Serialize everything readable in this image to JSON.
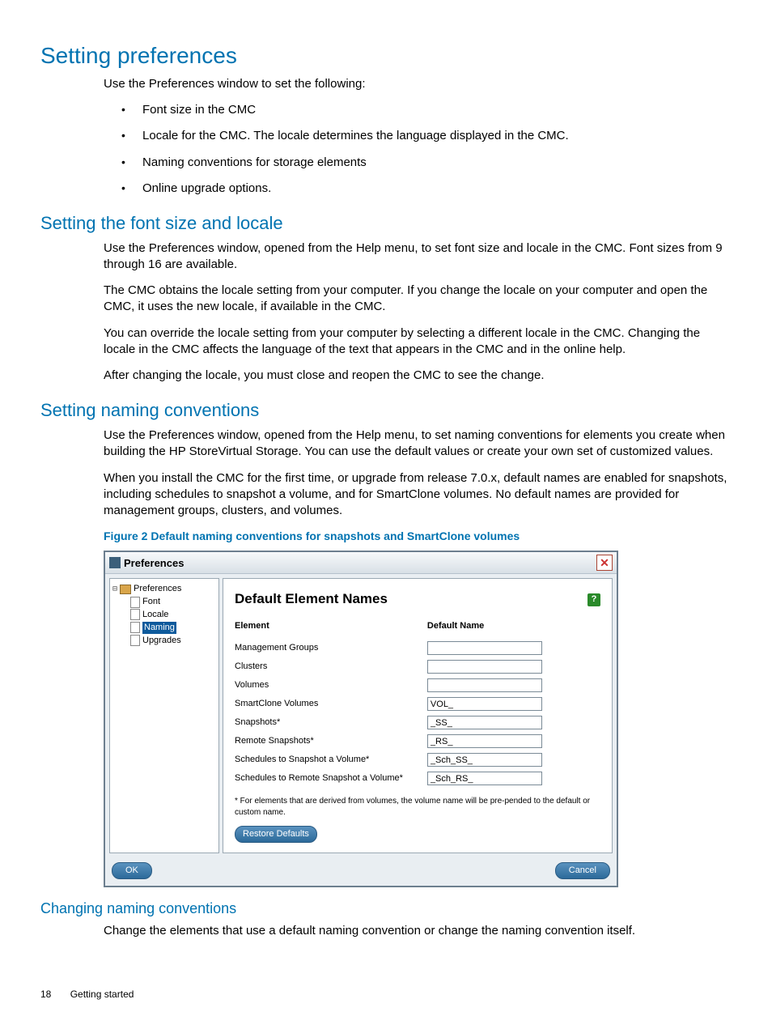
{
  "h1": "Setting preferences",
  "intro": "Use the Preferences window to set the following:",
  "bullets": [
    "Font size in the CMC",
    "Locale for the CMC. The locale determines the language displayed in the CMC.",
    "Naming conventions for storage elements",
    "Online upgrade options."
  ],
  "h2a": "Setting the font size and locale",
  "p2a": "Use the Preferences window, opened from the Help menu, to set font size and locale in the CMC. Font sizes from 9 through 16 are available.",
  "p2b": "The CMC obtains the locale setting from your computer. If you change the locale on your computer and open the CMC, it uses the new locale, if available in the CMC.",
  "p2c": "You can override the locale setting from your computer by selecting a different locale in the CMC. Changing the locale in the CMC affects the language of the text that appears in the CMC and in the online help.",
  "p2d": "After changing the locale, you must close and reopen the CMC to see the change.",
  "h2b": "Setting naming conventions",
  "p3a": "Use the Preferences window, opened from the Help menu, to set naming conventions for elements you create when building the HP StoreVirtual Storage. You can use the default values or create your own set of customized values.",
  "p3b": "When you install the CMC for the first time, or upgrade from release 7.0.x, default names are enabled for snapshots, including schedules to snapshot a volume, and for SmartClone volumes. No default names are provided for management groups, clusters, and volumes.",
  "figcap": "Figure 2 Default naming conventions for snapshots and SmartClone volumes",
  "dialog": {
    "title": "Preferences",
    "tree": {
      "root": "Preferences",
      "items": [
        "Font",
        "Locale",
        "Naming",
        "Upgrades"
      ],
      "selected": "Naming"
    },
    "panelTitle": "Default Element Names",
    "colElement": "Element",
    "colDefault": "Default Name",
    "rows": [
      {
        "label": "Management Groups",
        "value": ""
      },
      {
        "label": "Clusters",
        "value": ""
      },
      {
        "label": "Volumes",
        "value": ""
      },
      {
        "label": "SmartClone Volumes",
        "value": "VOL_"
      },
      {
        "label": "Snapshots*",
        "value": "_SS_"
      },
      {
        "label": "Remote Snapshots*",
        "value": "_RS_"
      },
      {
        "label": "Schedules to Snapshot a Volume*",
        "value": "_Sch_SS_"
      },
      {
        "label": "Schedules to Remote Snapshot a Volume*",
        "value": "_Sch_RS_"
      }
    ],
    "footnote": "* For elements that are derived from volumes, the volume name will be pre-pended to the default or custom name.",
    "restore": "Restore Defaults",
    "ok": "OK",
    "cancel": "Cancel"
  },
  "h3": "Changing naming conventions",
  "p4": "Change the elements that use a default naming convention or change the naming convention itself.",
  "pageNum": "18",
  "runningTitle": "Getting started"
}
